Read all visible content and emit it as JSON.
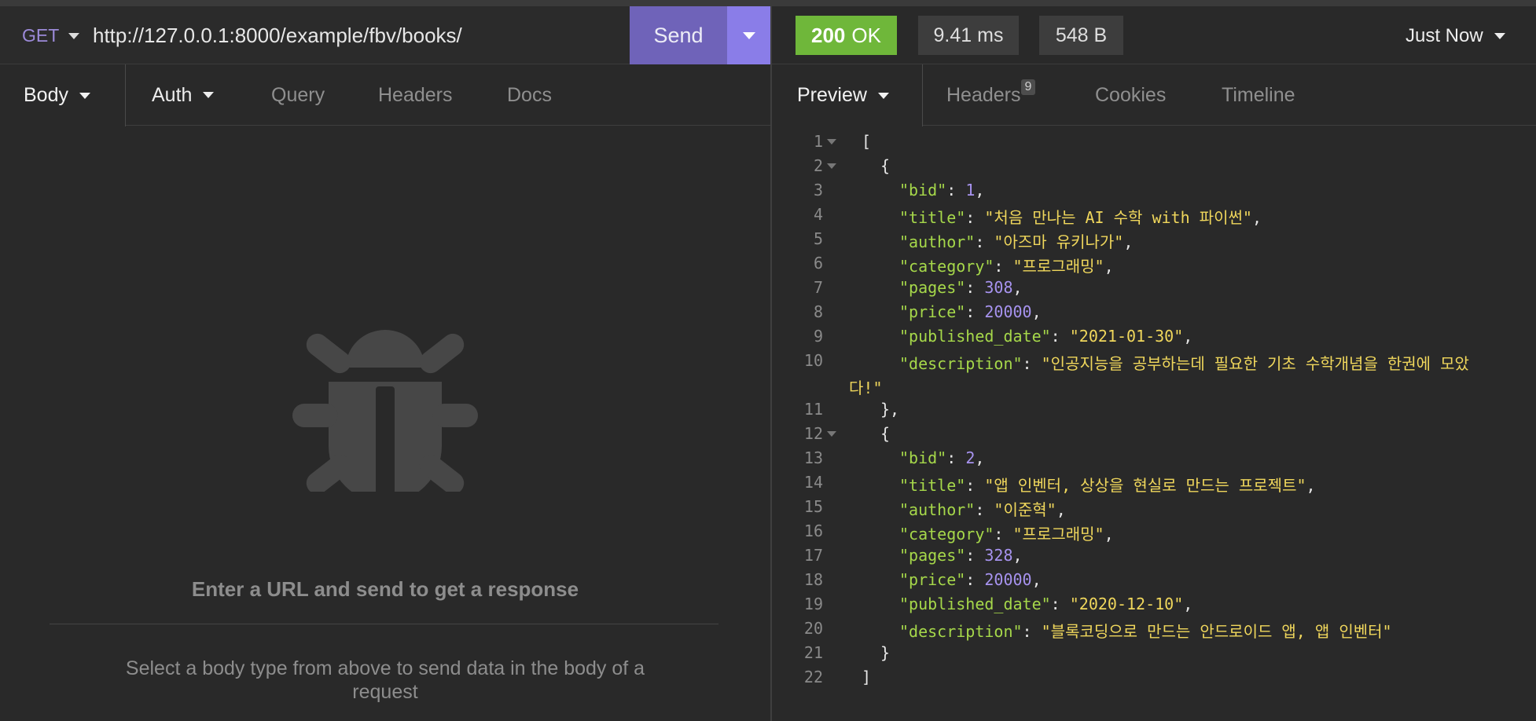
{
  "request": {
    "method": "GET",
    "url": "http://127.0.0.1:8000/example/fbv/books/",
    "send_label": "Send",
    "tabs": [
      "Body",
      "Auth",
      "Query",
      "Headers",
      "Docs"
    ],
    "empty_title": "Enter a URL and send to get a response",
    "empty_sub": "Select a body type from above to send data in the body of a request"
  },
  "response": {
    "status_code": "200",
    "status_text": "OK",
    "time": "9.41 ms",
    "size": "548 B",
    "history_label": "Just Now",
    "tabs": [
      "Preview",
      "Headers",
      "Cookies",
      "Timeline"
    ],
    "headers_count": "9",
    "colors": {
      "status": "#6fb73a",
      "key": "#a6d84a",
      "string": "#f0d75c",
      "number": "#a793ef",
      "accent": "#8a7de8"
    }
  },
  "code_lines": [
    {
      "n": "1",
      "fold": true,
      "indent": 0,
      "parts": [
        [
          "p",
          "["
        ]
      ]
    },
    {
      "n": "2",
      "fold": true,
      "indent": 1,
      "parts": [
        [
          "p",
          "{"
        ]
      ]
    },
    {
      "n": "3",
      "indent": 2,
      "parts": [
        [
          "k",
          "\"bid\""
        ],
        [
          "p",
          ": "
        ],
        [
          "n",
          "1"
        ],
        [
          "p",
          ","
        ]
      ]
    },
    {
      "n": "4",
      "indent": 2,
      "parts": [
        [
          "k",
          "\"title\""
        ],
        [
          "p",
          ": "
        ],
        [
          "s",
          "\"처음 만나는 AI 수학 with 파이썬\""
        ],
        [
          "p",
          ","
        ]
      ]
    },
    {
      "n": "5",
      "indent": 2,
      "parts": [
        [
          "k",
          "\"author\""
        ],
        [
          "p",
          ": "
        ],
        [
          "s",
          "\"아즈마 유키나가\""
        ],
        [
          "p",
          ","
        ]
      ]
    },
    {
      "n": "6",
      "indent": 2,
      "parts": [
        [
          "k",
          "\"category\""
        ],
        [
          "p",
          ": "
        ],
        [
          "s",
          "\"프로그래밍\""
        ],
        [
          "p",
          ","
        ]
      ]
    },
    {
      "n": "7",
      "indent": 2,
      "parts": [
        [
          "k",
          "\"pages\""
        ],
        [
          "p",
          ": "
        ],
        [
          "n",
          "308"
        ],
        [
          "p",
          ","
        ]
      ]
    },
    {
      "n": "8",
      "indent": 2,
      "parts": [
        [
          "k",
          "\"price\""
        ],
        [
          "p",
          ": "
        ],
        [
          "n",
          "20000"
        ],
        [
          "p",
          ","
        ]
      ]
    },
    {
      "n": "9",
      "indent": 2,
      "parts": [
        [
          "k",
          "\"published_date\""
        ],
        [
          "p",
          ": "
        ],
        [
          "s",
          "\"2021-01-30\""
        ],
        [
          "p",
          ","
        ]
      ]
    },
    {
      "n": "10",
      "indent": 2,
      "parts": [
        [
          "k",
          "\"description\""
        ],
        [
          "p",
          ": "
        ],
        [
          "s",
          "\"인공지능을 공부하는데 필요한 기초 수학개념을 한권에 모았"
        ]
      ]
    },
    {
      "n": "",
      "indent": 0,
      "parts": [
        [
          "s",
          "다!\""
        ]
      ]
    },
    {
      "n": "11",
      "indent": 1,
      "parts": [
        [
          "p",
          "},"
        ]
      ]
    },
    {
      "n": "12",
      "fold": true,
      "indent": 1,
      "parts": [
        [
          "p",
          "{"
        ]
      ]
    },
    {
      "n": "13",
      "indent": 2,
      "parts": [
        [
          "k",
          "\"bid\""
        ],
        [
          "p",
          ": "
        ],
        [
          "n",
          "2"
        ],
        [
          "p",
          ","
        ]
      ]
    },
    {
      "n": "14",
      "indent": 2,
      "parts": [
        [
          "k",
          "\"title\""
        ],
        [
          "p",
          ": "
        ],
        [
          "s",
          "\"앱 인벤터, 상상을 현실로 만드는 프로젝트\""
        ],
        [
          "p",
          ","
        ]
      ]
    },
    {
      "n": "15",
      "indent": 2,
      "parts": [
        [
          "k",
          "\"author\""
        ],
        [
          "p",
          ": "
        ],
        [
          "s",
          "\"이준혁\""
        ],
        [
          "p",
          ","
        ]
      ]
    },
    {
      "n": "16",
      "indent": 2,
      "parts": [
        [
          "k",
          "\"category\""
        ],
        [
          "p",
          ": "
        ],
        [
          "s",
          "\"프로그래밍\""
        ],
        [
          "p",
          ","
        ]
      ]
    },
    {
      "n": "17",
      "indent": 2,
      "parts": [
        [
          "k",
          "\"pages\""
        ],
        [
          "p",
          ": "
        ],
        [
          "n",
          "328"
        ],
        [
          "p",
          ","
        ]
      ]
    },
    {
      "n": "18",
      "indent": 2,
      "parts": [
        [
          "k",
          "\"price\""
        ],
        [
          "p",
          ": "
        ],
        [
          "n",
          "20000"
        ],
        [
          "p",
          ","
        ]
      ]
    },
    {
      "n": "19",
      "indent": 2,
      "parts": [
        [
          "k",
          "\"published_date\""
        ],
        [
          "p",
          ": "
        ],
        [
          "s",
          "\"2020-12-10\""
        ],
        [
          "p",
          ","
        ]
      ]
    },
    {
      "n": "20",
      "indent": 2,
      "parts": [
        [
          "k",
          "\"description\""
        ],
        [
          "p",
          ": "
        ],
        [
          "s",
          "\"블록코딩으로 만드는 안드로이드 앱, 앱 인벤터\""
        ]
      ]
    },
    {
      "n": "21",
      "indent": 1,
      "parts": [
        [
          "p",
          "}"
        ]
      ]
    },
    {
      "n": "22",
      "indent": 0,
      "parts": [
        [
          "p",
          "]"
        ]
      ]
    }
  ]
}
